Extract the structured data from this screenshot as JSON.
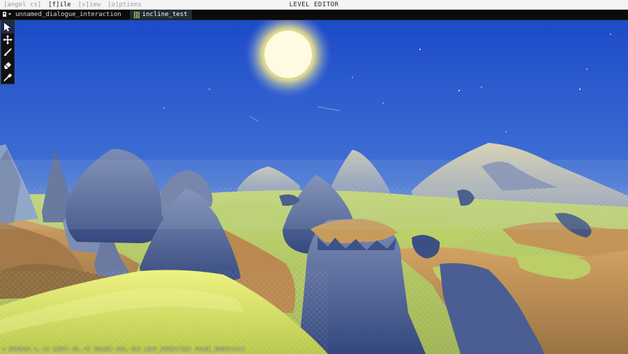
{
  "menu": {
    "items": [
      {
        "label": "[angel cs]",
        "state": "dim"
      },
      {
        "label": "[f]ile",
        "state": "active"
      },
      {
        "label": "[v]iew",
        "state": "dim"
      },
      {
        "label": "[o]ptions",
        "state": "dim"
      }
    ]
  },
  "app_title": "LEVEL EDITOR",
  "tabs": [
    {
      "label": "unnamed_dialogue_interaction",
      "active": false,
      "icon": "dialogue-icon"
    },
    {
      "label": "incline_test",
      "active": true,
      "icon": "terrain-grid-icon"
    }
  ],
  "tools": [
    {
      "name": "select-tool",
      "icon": "cursor-arrow-icon",
      "selected": true
    },
    {
      "name": "move-tool",
      "icon": "move-cross-icon",
      "selected": false
    },
    {
      "name": "brush-tool",
      "icon": "brush-icon",
      "selected": false
    },
    {
      "name": "eraser-tool",
      "icon": "eraser-icon",
      "selected": false
    },
    {
      "name": "eyedropper-tool",
      "icon": "eyedropper-icon",
      "selected": false
    }
  ],
  "status": {
    "text": "> BRANCH(-1,-1) LEAF(-10,-4) VALUE(-163,-62) LEAF_INDEX(732) VALUE_INDEX(114)"
  },
  "colors": {
    "sky_top": "#1f4fd0",
    "sky_horizon": "#8fb0d6",
    "sun": "#fffbd0",
    "terrain_green": "#b6cf5a",
    "terrain_brown": "#b98a55",
    "mountain_blue": "#44598f",
    "foreground_yellow": "#d4e05c"
  }
}
